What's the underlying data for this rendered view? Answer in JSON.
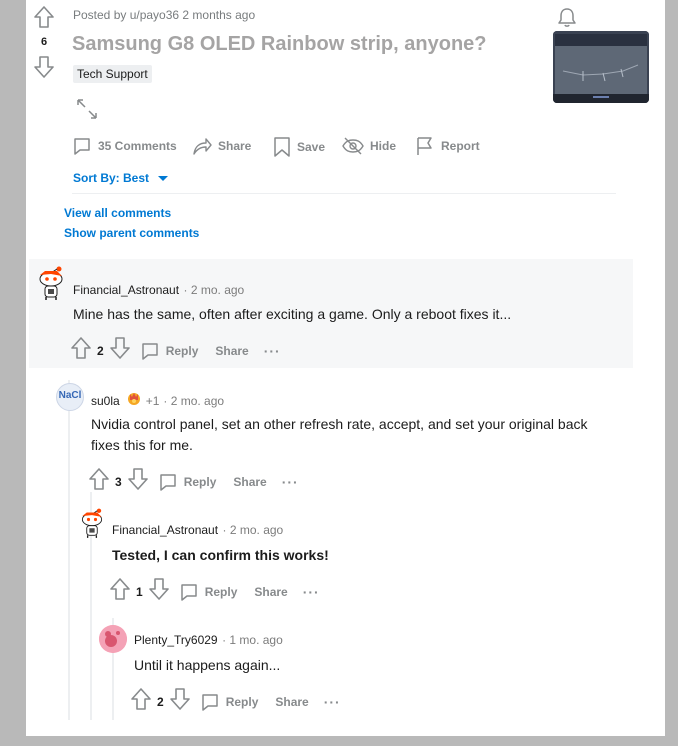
{
  "post": {
    "vote_count": "6",
    "posted_by": "Posted by u/payo36 2 months ago",
    "title": "Samsung G8 OLED Rainbow strip, anyone?",
    "flair": "Tech Support",
    "actions": {
      "comments": "35 Comments",
      "share": "Share",
      "save": "Save",
      "hide": "Hide",
      "report": "Report"
    },
    "sort_label": "Sort By: Best",
    "view_all": "View all comments",
    "show_parent": "Show parent comments"
  },
  "comments": [
    {
      "username": "Financial_Astronaut",
      "time": "· 2 mo. ago",
      "body": "Mine has the same, often after exciting a game. Only a reboot fixes it...",
      "score": "2",
      "reply": "Reply",
      "share": "Share",
      "more": "···"
    },
    {
      "username": "su0la",
      "avatar_text": "NaCl",
      "award_count": "+1",
      "time": "· 2 mo. ago",
      "body": "Nvidia control panel, set an other refresh rate, accept, and set your original back fixes this for me.",
      "score": "3",
      "reply": "Reply",
      "share": "Share",
      "more": "···"
    },
    {
      "username": "Financial_Astronaut",
      "time": "· 2 mo. ago",
      "body": "Tested, I can confirm this works!",
      "score": "1",
      "reply": "Reply",
      "share": "Share",
      "more": "···"
    },
    {
      "username": "Plenty_Try6029",
      "time": "· 1 mo. ago",
      "body": "Until it happens again...",
      "score": "2",
      "reply": "Reply",
      "share": "Share",
      "more": "···"
    }
  ],
  "colors": {
    "link_blue": "#0079d3",
    "highlight_bg": "#f6f7f8",
    "muted": "#878a8c"
  }
}
